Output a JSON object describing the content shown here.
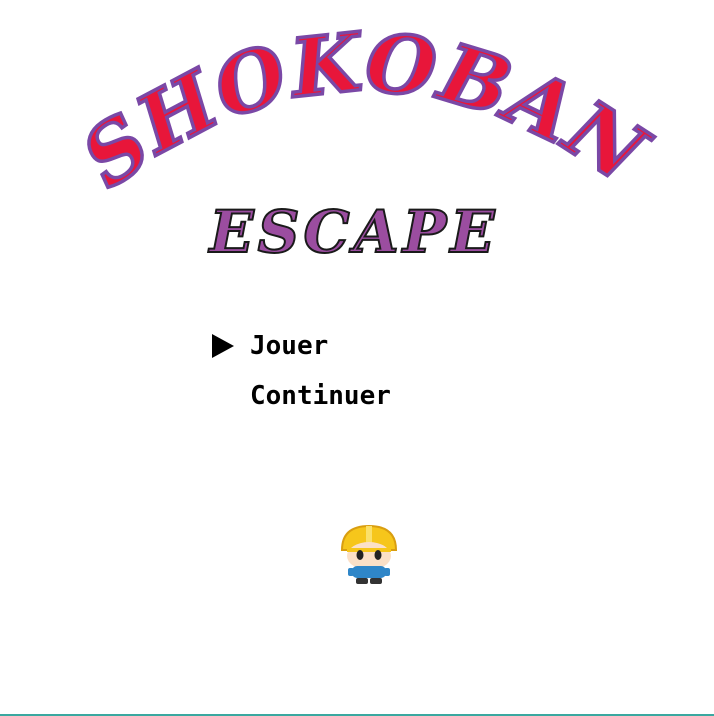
{
  "title": {
    "main": "SHOKOBAN",
    "sub": "ESCAPE",
    "colors": {
      "main_fill": "#e8163a",
      "main_stroke": "#7a48a6",
      "sub_fill": "#9b4da0",
      "sub_stroke": "#1a1a1a"
    }
  },
  "menu": {
    "items": [
      {
        "label": "Jouer",
        "selected": true
      },
      {
        "label": "Continuer",
        "selected": false
      }
    ],
    "cursor_icon": "triangle-right-icon"
  },
  "sprite": {
    "icon": "hardhat-worker-icon"
  },
  "colors": {
    "background": "#ffffff",
    "bottom_bar": "#3aa8a0"
  }
}
